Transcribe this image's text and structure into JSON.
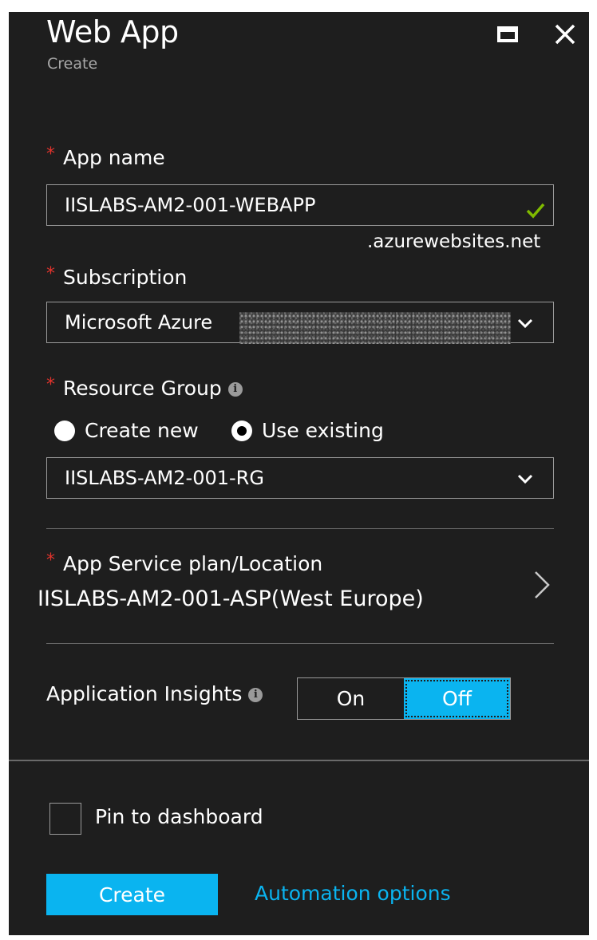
{
  "header": {
    "title": "Web App",
    "subtitle": "Create"
  },
  "form": {
    "app_name": {
      "label": "App name",
      "value": "IISLABS-AM2-001-WEBAPP",
      "suffix": ".azurewebsites.net"
    },
    "subscription": {
      "label": "Subscription",
      "value": "Microsoft Azure"
    },
    "resource_group": {
      "label": "Resource Group",
      "radio_create_new": "Create new",
      "radio_use_existing": "Use existing",
      "selected_option": "Use existing",
      "value": "IISLABS-AM2-001-RG"
    },
    "app_service_plan": {
      "label": "App Service plan/Location",
      "value": "IISLABS-AM2-001-ASP(West Europe)"
    },
    "app_insights": {
      "label": "Application Insights",
      "on_label": "On",
      "off_label": "Off",
      "selected": "Off"
    }
  },
  "footer": {
    "pin_label": "Pin to dashboard",
    "pinned": false,
    "create_label": "Create",
    "automation_label": "Automation options"
  },
  "colors": {
    "panel_bg": "#1e1e1e",
    "accent": "#0ab4f0",
    "required": "#e0332c",
    "valid_check": "#7fba00"
  }
}
